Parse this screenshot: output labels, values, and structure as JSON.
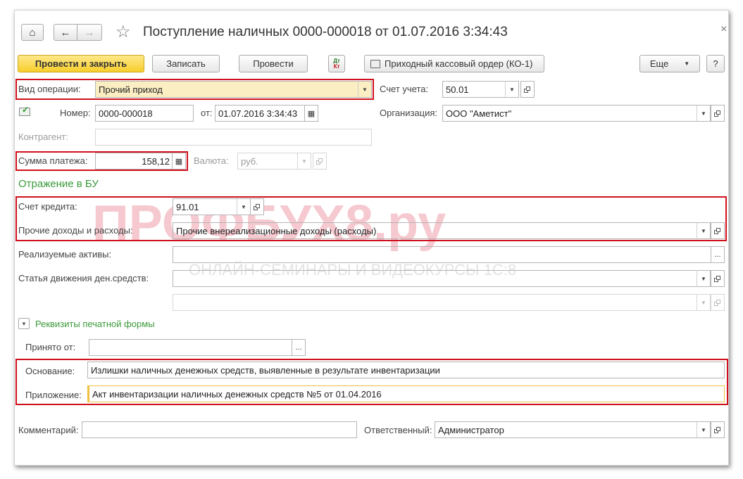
{
  "window": {
    "title": "Поступление наличных 0000-000018 от 01.07.2016 3:34:43",
    "close_glyph": "×",
    "home_glyph": "⌂",
    "back_glyph": "←",
    "forward_glyph": "→",
    "star_glyph": "☆"
  },
  "toolbar": {
    "post_and_close": "Провести и закрыть",
    "save": "Записать",
    "post": "Провести",
    "dt_kt_top": "Дт",
    "dt_kt_bottom": "Кт",
    "print_order": "Приходный кассовый ордер (КО-1)",
    "more": "Еще",
    "help": "?"
  },
  "form": {
    "operation_label": "Вид операции:",
    "operation_value": "Прочий приход",
    "account_label": "Счет учета:",
    "account_value": "50.01",
    "number_label": "Номер:",
    "number_value": "0000-000018",
    "date_label": "от:",
    "date_value": "01.07.2016  3:34:43",
    "org_label": "Организация:",
    "org_value": "ООО \"Аметист\"",
    "counterparty_label": "Контрагент:",
    "counterparty_value": "",
    "amount_label": "Сумма платежа:",
    "amount_value": "158,12",
    "currency_label": "Валюта:",
    "currency_value": "руб."
  },
  "bu_section": {
    "title": "Отражение в БУ",
    "credit_account_label": "Счет кредита:",
    "credit_account_value": "91.01",
    "income_label": "Прочие доходы и расходы:",
    "income_value": "Прочие внереализационные доходы (расходы)",
    "assets_label": "Реализуемые активы:",
    "assets_value": "",
    "cashflow_label": "Статья движения ден.средств:",
    "cashflow_value": "",
    "extra_value": ""
  },
  "print_section": {
    "toggle_label": "Реквизиты печатной формы",
    "received_from_label": "Принято от:",
    "received_from_value": "",
    "basis_label": "Основание:",
    "basis_value": "Излишки наличных денежных средств, выявленные в результате инвентаризации",
    "attachment_label": "Приложение:",
    "attachment_value": "Акт инвентаризации наличных денежных средств №5 от 01.04.2016"
  },
  "footer": {
    "comment_label": "Комментарий:",
    "comment_value": "",
    "responsible_label": "Ответственный:",
    "responsible_value": "Администратор"
  },
  "watermark": {
    "main": "ПРОФБУХ8.ру",
    "sub": "ОНЛАЙН-СЕМИНАРЫ И ВИДЕОКУРСЫ 1С:8"
  },
  "colors": {
    "highlight_red": "#d0101c",
    "section_green": "#3a9a3a",
    "primary_yellow": "#f7ce2c"
  }
}
